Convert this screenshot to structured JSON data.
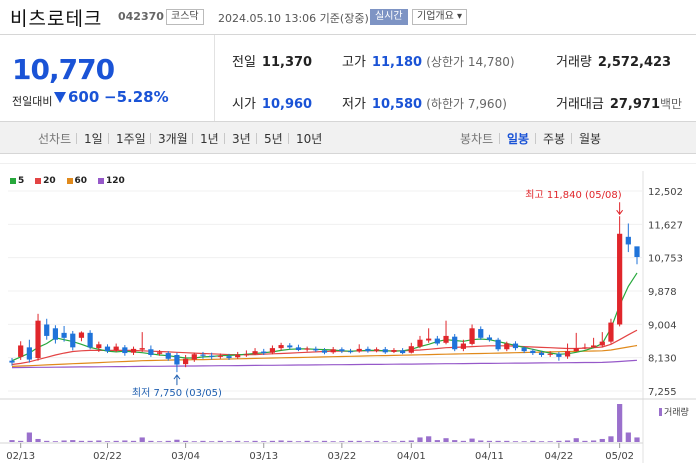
{
  "header": {
    "name": "비츠로테크",
    "code": "042370",
    "market": "코스닥",
    "timestamp": "2024.05.10 13:06 기준(장중)",
    "realtime_label": "실시간",
    "overview_label": "기업개요"
  },
  "summary": {
    "price": "10,770",
    "prev_label": "전일대비",
    "change": "600",
    "change_pct": "−5.28%",
    "prev_close_label": "전일",
    "prev_close": "11,370",
    "high_label": "고가",
    "high": "11,180",
    "upper_limit": "(상한가 14,780)",
    "volume_label": "거래량",
    "volume": "2,572,423",
    "open_label": "시가",
    "open": "10,960",
    "low_label": "저가",
    "low": "10,580",
    "lower_limit": "(하한가 7,960)",
    "value_label": "거래대금",
    "value": "27,971",
    "value_unit": "백만"
  },
  "tabs": {
    "line_label": "선차트",
    "periods": [
      "1일",
      "1주일",
      "3개월",
      "1년",
      "3년",
      "5년",
      "10년"
    ],
    "candle_label": "봉차트",
    "candle_periods": [
      "일봉",
      "주봉",
      "월봉"
    ],
    "active_candle": "일봉"
  },
  "colors": {
    "up": "#e0262b",
    "down": "#1f73d9",
    "ma5": "#27a83c",
    "ma20": "#e34444",
    "ma60": "#e08a1c",
    "ma120": "#9659c9",
    "accent": "#1a53d6"
  },
  "chart_data": {
    "type": "candlestick",
    "legend": [
      "5",
      "20",
      "60",
      "120"
    ],
    "y_ticks": [
      "12,502",
      "11,627",
      "10,753",
      "9,878",
      "9,004",
      "8,130",
      "7,255"
    ],
    "ylim": [
      7255,
      12502
    ],
    "x_ticks": [
      "02/13",
      "02/22",
      "03/04",
      "03/13",
      "03/22",
      "04/01",
      "04/11",
      "04/22",
      "05/02"
    ],
    "high_note": "최고 11,840 (05/08)",
    "low_note": "최저 7,750 (03/05)",
    "volume_label": "거래량",
    "candles": [
      [
        8050,
        8000,
        8120,
        7920
      ],
      [
        8150,
        8450,
        8560,
        8070
      ],
      [
        8400,
        8080,
        8600,
        8000
      ],
      [
        8120,
        9100,
        9280,
        8050
      ],
      [
        9000,
        8700,
        9150,
        8600
      ],
      [
        8900,
        8600,
        8980,
        8500
      ],
      [
        8780,
        8650,
        8960,
        8550
      ],
      [
        8760,
        8400,
        8830,
        8320
      ],
      [
        8650,
        8790,
        8820,
        8560
      ],
      [
        8780,
        8400,
        8850,
        8350
      ],
      [
        8380,
        8480,
        8550,
        8280
      ],
      [
        8420,
        8300,
        8480,
        8250
      ],
      [
        8330,
        8420,
        8500,
        8280
      ],
      [
        8400,
        8250,
        8460,
        8180
      ],
      [
        8260,
        8360,
        8420,
        8200
      ],
      [
        8340,
        8380,
        8800,
        8280
      ],
      [
        8350,
        8200,
        8450,
        8150
      ],
      [
        8230,
        8270,
        8330,
        8180
      ],
      [
        8250,
        8100,
        8300,
        8050
      ],
      [
        8200,
        7950,
        8260,
        7750
      ],
      [
        7960,
        8100,
        8200,
        7880
      ],
      [
        8080,
        8220,
        8260,
        8020
      ],
      [
        8210,
        8180,
        8280,
        8100
      ],
      [
        8180,
        8150,
        8260,
        8080
      ],
      [
        8150,
        8180,
        8240,
        8100
      ],
      [
        8170,
        8120,
        8230,
        8070
      ],
      [
        8140,
        8200,
        8280,
        8100
      ],
      [
        8190,
        8220,
        8320,
        8150
      ],
      [
        8230,
        8300,
        8380,
        8200
      ],
      [
        8290,
        8250,
        8360,
        8200
      ],
      [
        8260,
        8380,
        8450,
        8220
      ],
      [
        8380,
        8460,
        8520,
        8320
      ],
      [
        8450,
        8400,
        8510,
        8350
      ],
      [
        8400,
        8330,
        8470,
        8300
      ],
      [
        8340,
        8370,
        8420,
        8290
      ],
      [
        8360,
        8320,
        8420,
        8280
      ],
      [
        8320,
        8260,
        8380,
        8220
      ],
      [
        8270,
        8350,
        8410,
        8230
      ],
      [
        8350,
        8300,
        8400,
        8250
      ],
      [
        8300,
        8280,
        8360,
        8240
      ],
      [
        8290,
        8360,
        8480,
        8260
      ],
      [
        8360,
        8300,
        8420,
        8260
      ],
      [
        8310,
        8350,
        8400,
        8270
      ],
      [
        8350,
        8270,
        8410,
        8230
      ],
      [
        8280,
        8330,
        8380,
        8250
      ],
      [
        8320,
        8250,
        8380,
        8220
      ],
      [
        8260,
        8430,
        8520,
        8240
      ],
      [
        8420,
        8600,
        8700,
        8380
      ],
      [
        8580,
        8630,
        8900,
        8520
      ],
      [
        8630,
        8500,
        8700,
        8450
      ],
      [
        8520,
        8700,
        9100,
        8480
      ],
      [
        8680,
        8350,
        8750,
        8300
      ],
      [
        8360,
        8500,
        8600,
        8300
      ],
      [
        8490,
        8900,
        9000,
        8450
      ],
      [
        8880,
        8650,
        8950,
        8600
      ],
      [
        8660,
        8600,
        8730,
        8550
      ],
      [
        8600,
        8350,
        8650,
        8300
      ],
      [
        8350,
        8500,
        8550,
        8300
      ],
      [
        8500,
        8380,
        8560,
        8320
      ],
      [
        8390,
        8300,
        8420,
        8250
      ],
      [
        8310,
        8250,
        8360,
        8200
      ],
      [
        8260,
        8200,
        8300,
        8150
      ],
      [
        8210,
        8230,
        8300,
        8150
      ],
      [
        8230,
        8150,
        8280,
        8050
      ],
      [
        8160,
        8300,
        8500,
        8100
      ],
      [
        8300,
        8380,
        8780,
        8280
      ],
      [
        8390,
        8400,
        8500,
        8350
      ],
      [
        8400,
        8450,
        8650,
        8380
      ],
      [
        8450,
        8550,
        8800,
        8400
      ],
      [
        8550,
        9050,
        9150,
        8500
      ],
      [
        9000,
        11380,
        11840,
        8950
      ],
      [
        11300,
        11100,
        11650,
        10900
      ],
      [
        11050,
        10770,
        11000,
        10580
      ]
    ],
    "volumes": [
      0.05,
      0.03,
      0.25,
      0.08,
      0.03,
      0.02,
      0.04,
      0.05,
      0.03,
      0.03,
      0.04,
      0.02,
      0.03,
      0.04,
      0.03,
      0.12,
      0.03,
      0.02,
      0.03,
      0.06,
      0.03,
      0.02,
      0.03,
      0.02,
      0.03,
      0.02,
      0.03,
      0.02,
      0.03,
      0.02,
      0.03,
      0.04,
      0.03,
      0.02,
      0.03,
      0.02,
      0.03,
      0.02,
      0.02,
      0.03,
      0.03,
      0.02,
      0.03,
      0.02,
      0.02,
      0.03,
      0.04,
      0.12,
      0.15,
      0.05,
      0.1,
      0.05,
      0.03,
      0.09,
      0.04,
      0.03,
      0.03,
      0.03,
      0.02,
      0.02,
      0.03,
      0.02,
      0.02,
      0.03,
      0.04,
      0.1,
      0.03,
      0.04,
      0.08,
      0.15,
      1.0,
      0.25,
      0.12
    ],
    "ma5": [
      8050,
      8150,
      8250,
      8400,
      8500,
      8650,
      8600,
      8550,
      8480,
      8400,
      8350,
      8300,
      8280,
      8300,
      8280,
      8260,
      8230,
      8200,
      8180,
      8150,
      8120,
      8120,
      8150,
      8160,
      8180,
      8190,
      8200,
      8220,
      8240,
      8260,
      8280,
      8320,
      8350,
      8360,
      8360,
      8350,
      8340,
      8330,
      8310,
      8300,
      8310,
      8320,
      8320,
      8310,
      8300,
      8310,
      8350,
      8420,
      8480,
      8550,
      8600,
      8580,
      8560,
      8600,
      8620,
      8600,
      8550,
      8500,
      8450,
      8400,
      8350,
      8300,
      8250,
      8220,
      8230,
      8270,
      8320,
      8390,
      8500,
      8900,
      9500,
      10000,
      10350
    ],
    "ma20": [
      7950,
      7980,
      8020,
      8080,
      8140,
      8200,
      8250,
      8290,
      8310,
      8320,
      8320,
      8320,
      8320,
      8320,
      8320,
      8310,
      8300,
      8290,
      8280,
      8270,
      8260,
      8250,
      8240,
      8230,
      8220,
      8210,
      8210,
      8210,
      8210,
      8220,
      8230,
      8240,
      8250,
      8260,
      8270,
      8280,
      8290,
      8300,
      8300,
      8300,
      8310,
      8310,
      8310,
      8310,
      8310,
      8310,
      8320,
      8330,
      8350,
      8370,
      8390,
      8400,
      8410,
      8420,
      8430,
      8440,
      8440,
      8440,
      8430,
      8420,
      8410,
      8400,
      8390,
      8380,
      8370,
      8370,
      8380,
      8390,
      8410,
      8480,
      8600,
      8730,
      8850
    ],
    "ma60": [
      7900,
      7910,
      7920,
      7930,
      7940,
      7950,
      7960,
      7970,
      7980,
      7990,
      8000,
      8010,
      8020,
      8030,
      8040,
      8050,
      8055,
      8060,
      8065,
      8070,
      8070,
      8075,
      8080,
      8085,
      8090,
      8095,
      8100,
      8105,
      8110,
      8115,
      8120,
      8125,
      8130,
      8135,
      8140,
      8145,
      8150,
      8155,
      8160,
      8165,
      8170,
      8175,
      8180,
      8185,
      8190,
      8195,
      8200,
      8205,
      8210,
      8215,
      8220,
      8225,
      8230,
      8235,
      8240,
      8245,
      8250,
      8255,
      8260,
      8265,
      8270,
      8275,
      8280,
      8285,
      8290,
      8295,
      8300,
      8305,
      8310,
      8330,
      8370,
      8410,
      8450
    ],
    "ma120": [
      7870,
      7872,
      7874,
      7876,
      7878,
      7880,
      7882,
      7884,
      7886,
      7888,
      7890,
      7892,
      7894,
      7896,
      7898,
      7900,
      7902,
      7904,
      7906,
      7908,
      7910,
      7912,
      7914,
      7916,
      7918,
      7920,
      7922,
      7924,
      7926,
      7928,
      7930,
      7932,
      7934,
      7936,
      7938,
      7940,
      7942,
      7944,
      7946,
      7948,
      7950,
      7952,
      7954,
      7956,
      7958,
      7960,
      7962,
      7964,
      7966,
      7968,
      7970,
      7972,
      7974,
      7976,
      7978,
      7980,
      7982,
      7984,
      7986,
      7988,
      7990,
      7992,
      7994,
      7996,
      7998,
      8000,
      8002,
      8004,
      8006,
      8015,
      8030,
      8045,
      8060
    ]
  }
}
